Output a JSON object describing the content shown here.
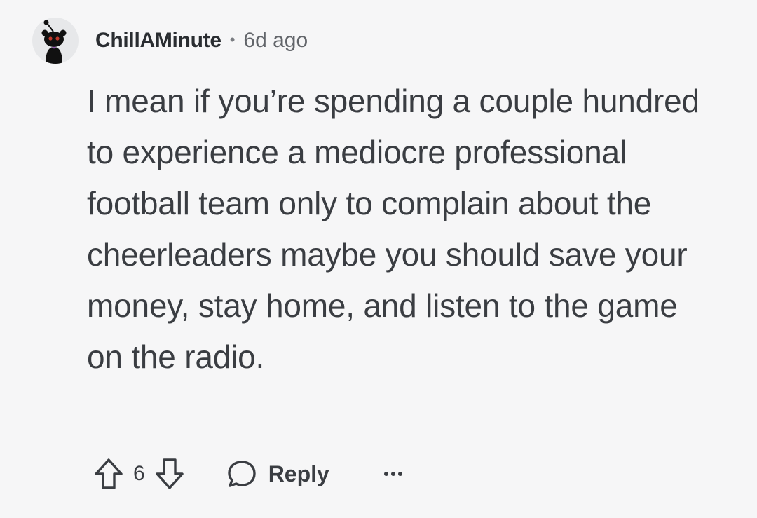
{
  "comment": {
    "author": "ChillAMinute",
    "separator": "•",
    "timestamp": "6d ago",
    "avatar_icon": "reddit-snoo-avatar-icon",
    "body": "I mean if you’re spending a couple hundred to experience a mediocre professional football team only to complain about the cheerleaders maybe you should save your money, stay home, and listen to the game on the radio.",
    "score": "6",
    "actions": {
      "upvote_icon": "upvote-arrow-icon",
      "downvote_icon": "downvote-arrow-icon",
      "reply_icon": "speech-bubble-icon",
      "reply_label": "Reply",
      "more_icon": "ellipsis-icon"
    }
  },
  "colors": {
    "background": "#f6f6f7",
    "text": "#3a3d42",
    "meta": "#62656a"
  }
}
